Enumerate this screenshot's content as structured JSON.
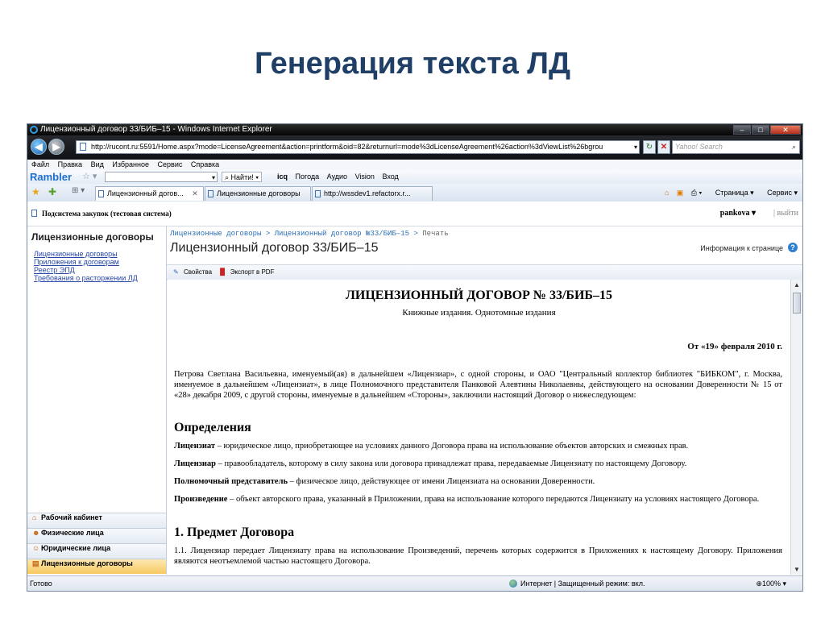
{
  "slide": {
    "title": "Генерация текста ЛД"
  },
  "window": {
    "title": "Лицензионный договор 33/БИБ–15 - Windows Internet Explorer",
    "address": "http://rucont.ru:5591/Home.aspx?mode=LicenseAgreement&action=printform&oid=82&returnurl=mode%3dLicenseAgreement%26action%3dViewList%26bgrou",
    "search_placeholder": "Yahoo! Search"
  },
  "menu": [
    "Файл",
    "Правка",
    "Вид",
    "Избранное",
    "Сервис",
    "Справка"
  ],
  "rambler": {
    "logo": "Rambler",
    "find": "Найти!",
    "items": [
      "icq",
      "Погода",
      "Аудио",
      "Vision",
      "Вход"
    ]
  },
  "tabs": [
    {
      "label": "Лицензионный догов..."
    },
    {
      "label": "Лицензионные договоры"
    },
    {
      "label": "http://wssdev1.refactorx.r..."
    }
  ],
  "commands": {
    "page": "Страница",
    "service": "Сервис"
  },
  "app": {
    "site_title": "Подсистема закупок (тестовая система)",
    "user": "pankova",
    "logout": "выйти"
  },
  "nav": {
    "heading": "Лицензионные договоры",
    "links": [
      "Лицензионные договоры",
      "Приложения к договорам",
      "Реестр ЭПД",
      "Требования о расторжении ЛД"
    ],
    "bottom": [
      "Рабочий кабинет",
      "Физические лица",
      "Юридические лица",
      "Лицензионные договоры"
    ]
  },
  "main": {
    "breadcrumb": [
      "Лицензионные договоры",
      "Лицензионный договор №33/БИБ–15",
      "Печать"
    ],
    "title": "Лицензионный договор 33/БИБ–15",
    "page_info": "Информация к странице",
    "actions": [
      "Свойства",
      "Экспорт в PDF"
    ]
  },
  "document": {
    "title": "ЛИЦЕНЗИОННЫЙ ДОГОВОР № 33/БИБ–15",
    "subtitle": "Книжные издания. Однотомные издания",
    "date": "От «19» февраля 2010 г.",
    "intro": "Петрова Светлана Васильевна, именуемый(ая) в дальнейшем «Лицензиар», с одной стороны, и ОАО \"Центральный коллектор библиотек \"БИБКОМ\", г. Москва, именуемое в дальнейшем «Лицензиат», в лице Полномочного представителя Панковой Алевтины Николаевны, действующего на основании Доверенности № 15 от «28» декабря 2009, с другой стороны, именуемые в дальнейшем «Стороны», заключили настоящий Договор о нижеследующем:",
    "definitions_heading": "Определения",
    "definitions": [
      {
        "term": "Лицензиат",
        "text": " – юридическое лицо, приобретающее на условиях данного Договора права на использование объектов авторских и смежных прав."
      },
      {
        "term": "Лицензиар",
        "text": " – правообладатель, которому в силу закона или договора принадлежат права, передаваемые Лицензиату по настоящему Договору."
      },
      {
        "term": "Полномочный представитель",
        "text": " – физическое лицо, действующее от имени Лицензиата на основании Доверенности."
      },
      {
        "term": "Произведение",
        "text": " – объект авторского права, указанный в Приложении, права на использование которого передаются Лицензиату на условиях настоящего Договора."
      }
    ],
    "section1_heading": "1. Предмет Договора",
    "section1_text": "1.1. Лицензиар передает Лицензиату права на использование Произведений, перечень которых содержится в Приложениях к настоящему Договору. Приложения являются неотъемлемой частью настоящего Договора."
  },
  "status": {
    "ready": "Готово",
    "zone": "Интернет | Защищенный режим: вкл.",
    "zoom": "100%"
  }
}
